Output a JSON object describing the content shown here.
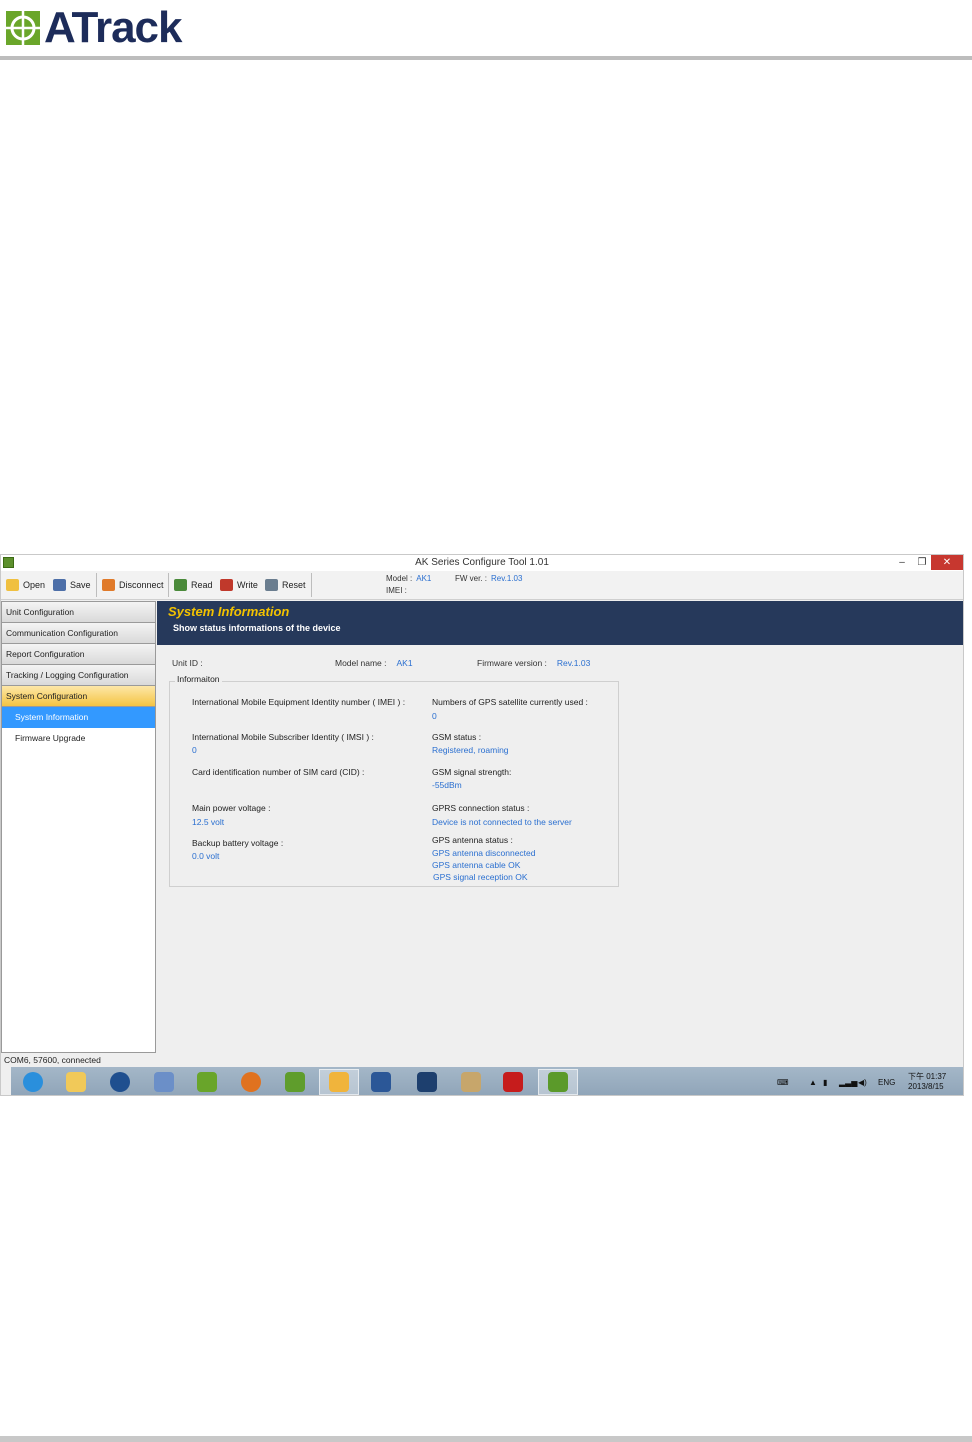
{
  "document": {
    "logo_text": "ATrack"
  },
  "window": {
    "title": "AK Series Configure Tool 1.01",
    "controls": {
      "minimize": "–",
      "restore": "❐",
      "close": "✕"
    }
  },
  "toolbar": {
    "open_label": "Open",
    "save_label": "Save",
    "disconnect_label": "Disconnect",
    "read_label": "Read",
    "write_label": "Write",
    "reset_label": "Reset",
    "model_label": "Model :",
    "model_value": "AK1",
    "fw_label": "FW ver. :",
    "fw_value": "Rev.1.03",
    "imei_label": "IMEI :"
  },
  "sidebar": {
    "categories": [
      {
        "label": "Unit Configuration"
      },
      {
        "label": "Communication Configuration"
      },
      {
        "label": "Report Configuration"
      },
      {
        "label": "Tracking / Logging Configuration"
      },
      {
        "label": "System Configuration"
      }
    ],
    "sub_items": [
      {
        "label": "System Information"
      },
      {
        "label": "Firmware Upgrade"
      }
    ]
  },
  "banner": {
    "title": "System Information",
    "subtitle": "Show status informations of the device"
  },
  "header_row": {
    "unit_id_label": "Unit ID :",
    "model_name_label": "Model name :",
    "model_name_value": "AK1",
    "firmware_label": "Firmware version :",
    "firmware_value": "Rev.1.03"
  },
  "info": {
    "legend": "Informaiton",
    "imei_label": "International Mobile Equipment Identity number ( IMEI ) :",
    "imsi_label": "International Mobile Subscriber Identity ( IMSI ) :",
    "imsi_value": "0",
    "cid_label": "Card identification number of SIM card (CID) :",
    "main_power_label": "Main power voltage :",
    "main_power_value": "12.5 volt",
    "backup_label": "Backup battery voltage :",
    "backup_value": "0.0 volt",
    "gps_sat_label": "Numbers of GPS satellite currently used :",
    "gps_sat_value": "0",
    "gsm_status_label": "GSM status :",
    "gsm_status_value": "Registered, roaming",
    "gsm_signal_label": "GSM signal strength:",
    "gsm_signal_value": "-55dBm",
    "gprs_label": "GPRS connection status :",
    "gprs_value": "Device is not connected to the server",
    "gps_antenna_label": "GPS antenna status :",
    "gps_antenna_values": [
      "GPS antenna disconnected",
      "GPS antenna cable OK",
      "GPS signal reception OK"
    ]
  },
  "statusbar": {
    "text": "COM6, 57600, connected"
  },
  "taskbar": {
    "lang": "ENG",
    "time": "下午 01:37",
    "date": "2013/8/15"
  }
}
